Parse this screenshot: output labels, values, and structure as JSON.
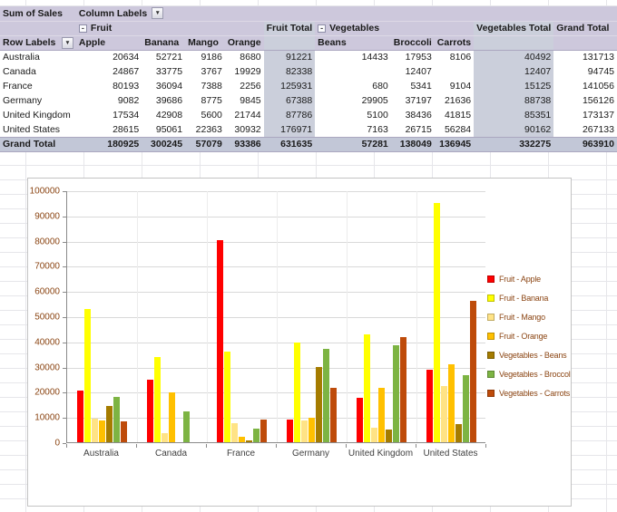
{
  "pivot": {
    "title": "Sum of Sales",
    "column_labels_label": "Column Labels",
    "row_labels_label": "Row Labels",
    "fruit_group_label": "Fruit",
    "vegetables_group_label": "Vegetables",
    "fruit_total_label": "Fruit Total",
    "vegetables_total_label": "Vegetables Total",
    "grand_total_label": "Grand Total",
    "fruit_columns": [
      "Apple",
      "Banana",
      "Mango",
      "Orange"
    ],
    "vegetable_columns": [
      "Beans",
      "Broccoli",
      "Carrots"
    ],
    "rows": [
      {
        "label": "Australia",
        "values": [
          "20634",
          "52721",
          "9186",
          "8680",
          "91221",
          "14433",
          "17953",
          "8106",
          "40492",
          "131713"
        ]
      },
      {
        "label": "Canada",
        "values": [
          "24867",
          "33775",
          "3767",
          "19929",
          "82338",
          "",
          "12407",
          "",
          "12407",
          "94745"
        ]
      },
      {
        "label": "France",
        "values": [
          "80193",
          "36094",
          "7388",
          "2256",
          "125931",
          "680",
          "5341",
          "9104",
          "15125",
          "141056"
        ]
      },
      {
        "label": "Germany",
        "values": [
          "9082",
          "39686",
          "8775",
          "9845",
          "67388",
          "29905",
          "37197",
          "21636",
          "88738",
          "156126"
        ]
      },
      {
        "label": "United Kingdom",
        "values": [
          "17534",
          "42908",
          "5600",
          "21744",
          "87786",
          "5100",
          "38436",
          "41815",
          "85351",
          "173137"
        ]
      },
      {
        "label": "United States",
        "values": [
          "28615",
          "95061",
          "22363",
          "30932",
          "176971",
          "7163",
          "26715",
          "56284",
          "90162",
          "267133"
        ]
      }
    ],
    "grand_total_row": {
      "label": "Grand Total",
      "values": [
        "180925",
        "300245",
        "57079",
        "93386",
        "631635",
        "57281",
        "138049",
        "136945",
        "332275",
        "963910"
      ]
    }
  },
  "icons": {
    "dropdown": "▼",
    "collapse": "-"
  },
  "chart_data": {
    "type": "bar",
    "title": "",
    "xlabel": "",
    "ylabel": "",
    "categories": [
      "Australia",
      "Canada",
      "France",
      "Germany",
      "United Kingdom",
      "United States"
    ],
    "series": [
      {
        "name": "Fruit - Apple",
        "color": "#FF0000",
        "values": [
          20634,
          24867,
          80193,
          9082,
          17534,
          28615
        ]
      },
      {
        "name": "Fruit - Banana",
        "color": "#FFFF00",
        "values": [
          52721,
          33775,
          36094,
          39686,
          42908,
          95061
        ]
      },
      {
        "name": "Fruit - Mango",
        "color": "#FFE385",
        "values": [
          9186,
          3767,
          7388,
          8775,
          5600,
          22363
        ]
      },
      {
        "name": "Fruit - Orange",
        "color": "#FFC000",
        "values": [
          8680,
          19929,
          2256,
          9845,
          21744,
          30932
        ]
      },
      {
        "name": "Vegetables - Beans",
        "color": "#A57C00",
        "values": [
          14433,
          0,
          680,
          29905,
          5100,
          7163
        ]
      },
      {
        "name": "Vegetables - Broccoli",
        "color": "#7DB443",
        "values": [
          17953,
          12407,
          5341,
          37197,
          38436,
          26715
        ]
      },
      {
        "name": "Vegetables - Carrots",
        "color": "#BE4B0A",
        "values": [
          8106,
          0,
          9104,
          21636,
          41815,
          56284
        ]
      }
    ],
    "ylim": [
      0,
      100000
    ],
    "ytick": 10000,
    "ytick_labels": [
      "0",
      "10000",
      "20000",
      "30000",
      "40000",
      "50000",
      "60000",
      "70000",
      "80000",
      "90000",
      "100000"
    ],
    "grid": true,
    "legend_position": "right"
  },
  "theme": {
    "header_fill": "#CDC8DC",
    "subtotal_fill": "#CBCFDB",
    "grand_fill": "#C2C7D7",
    "header_border": "#ABA7C0",
    "sheet_grid_color": "#E6E6EA",
    "chart_border": "#C3C3C3",
    "axis_color": "#8A8A8A",
    "plot_gridline_color": "#D9D9D9",
    "y_label_color": "#8B4513",
    "x_label_color": "#404040",
    "legend_text_color": "#8B4513"
  }
}
